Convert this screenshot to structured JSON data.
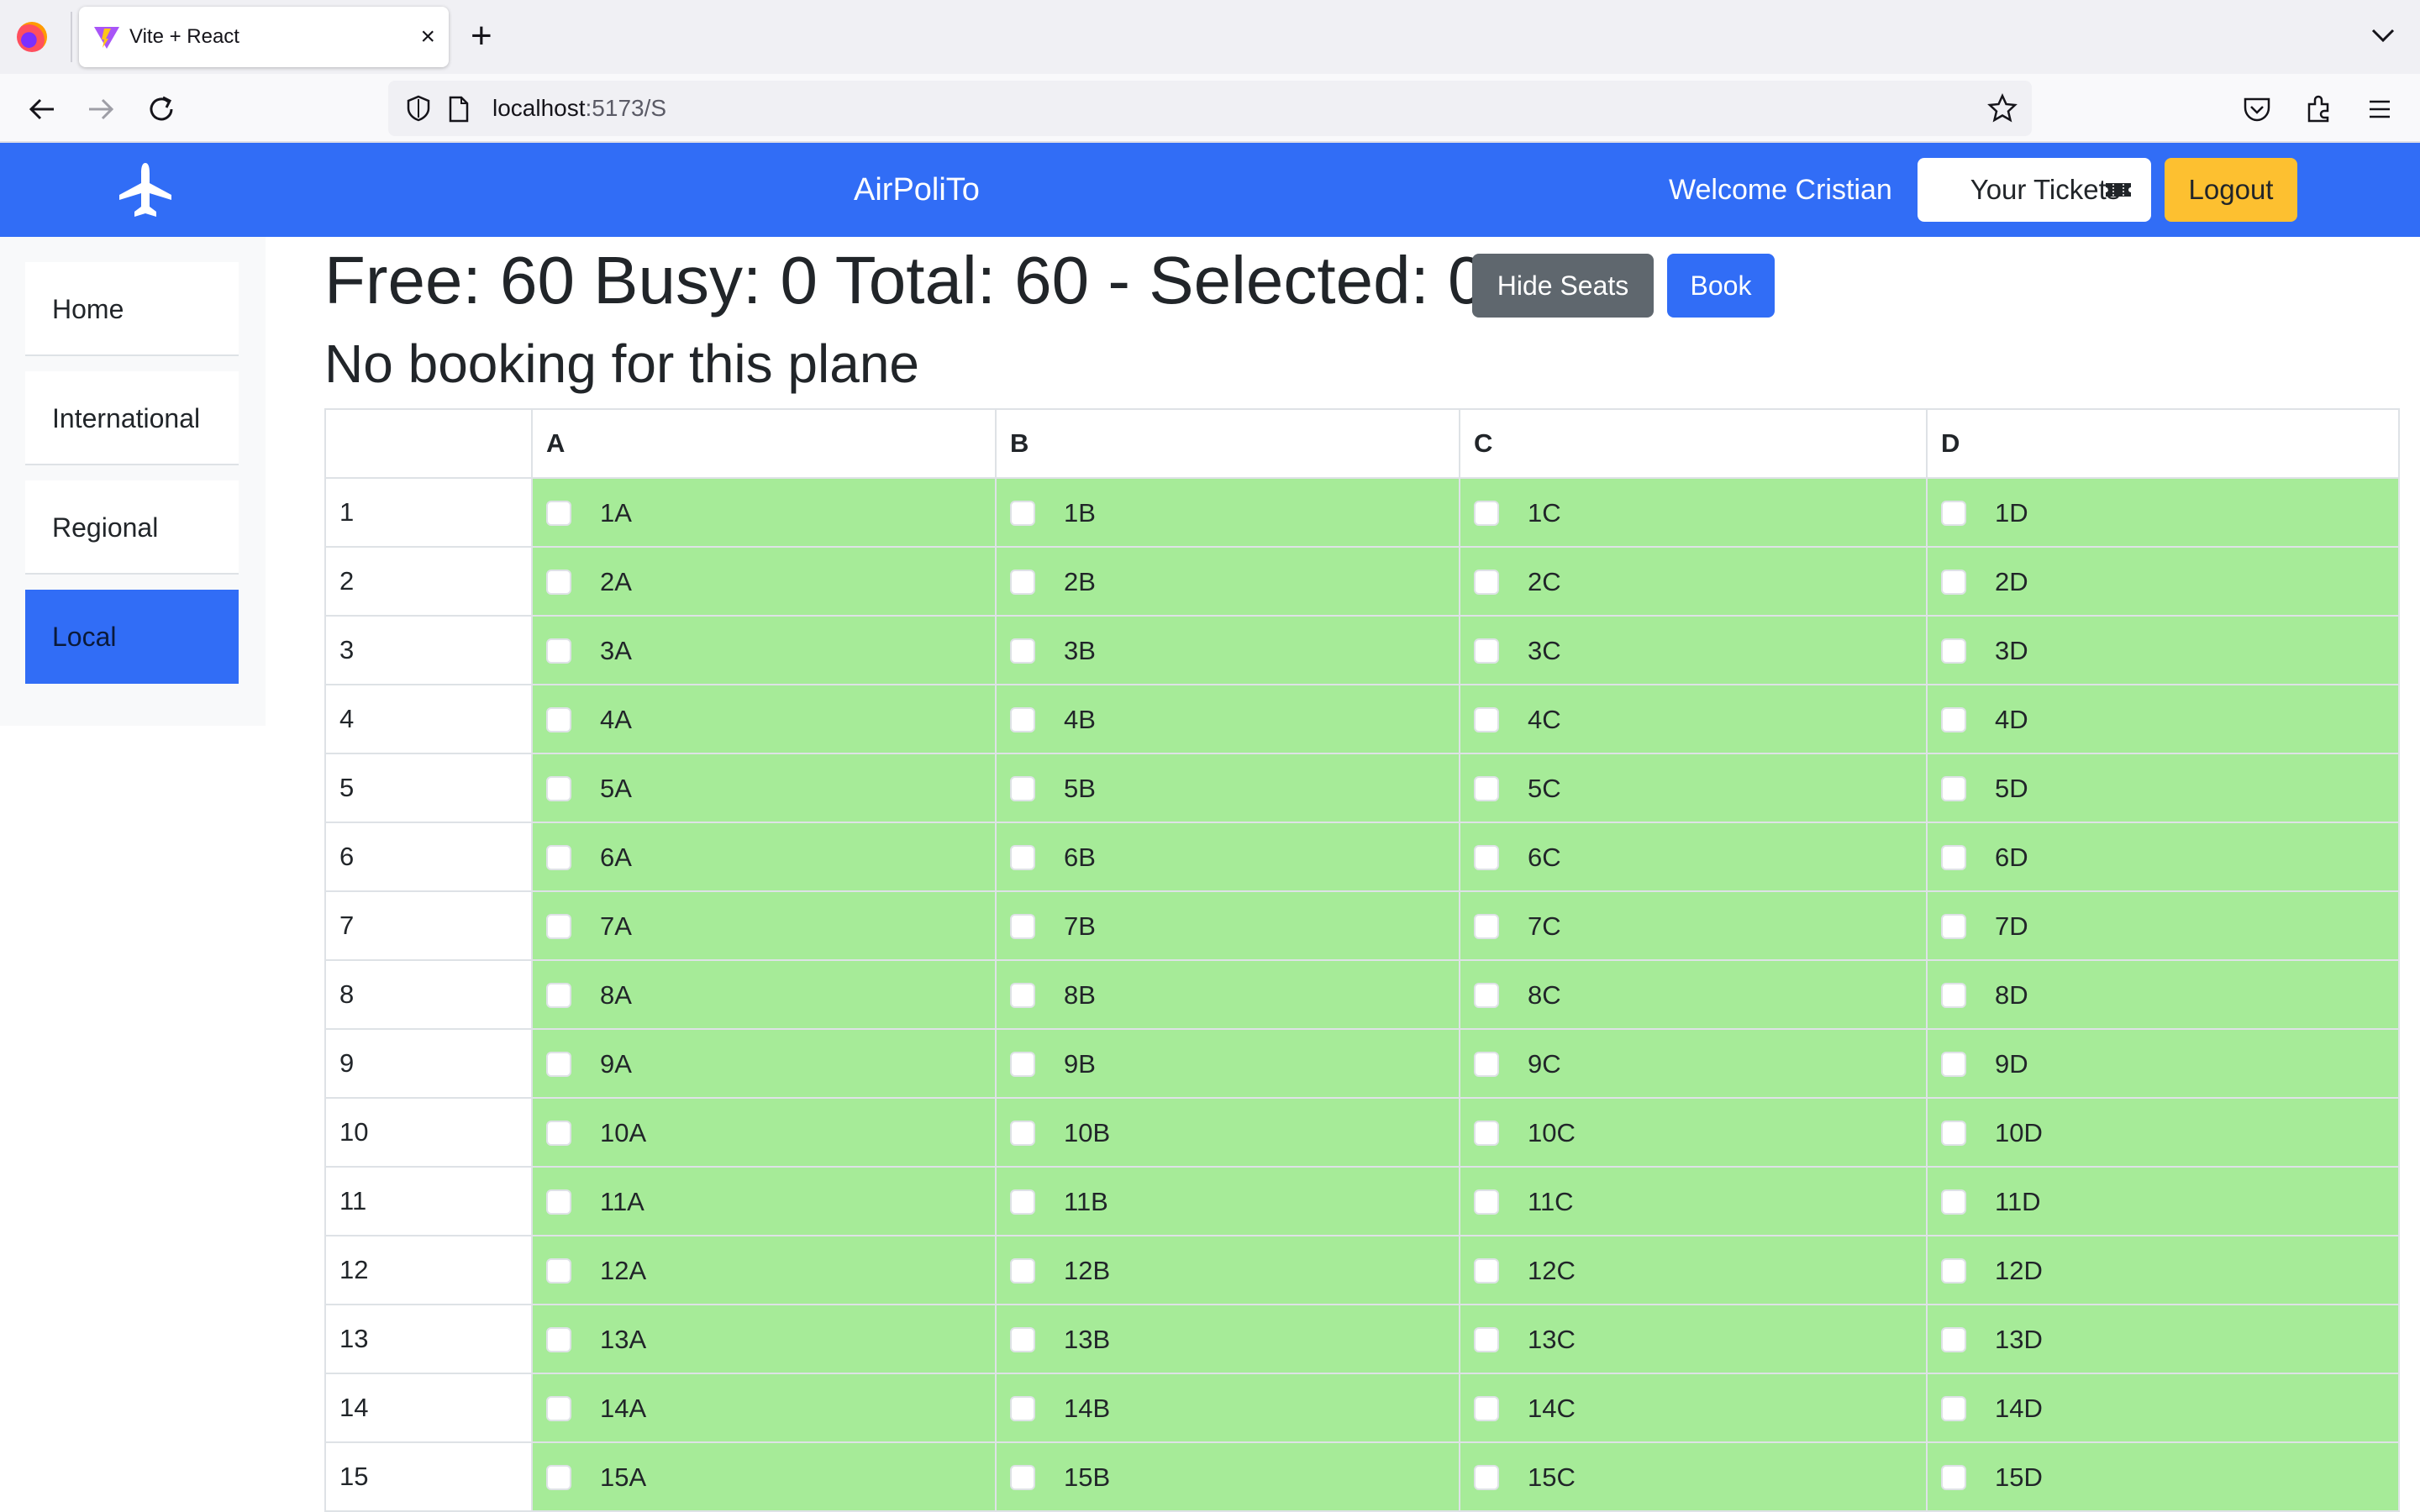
{
  "browser": {
    "tab_title": "Vite + React",
    "close_glyph": "×",
    "new_tab_glyph": "+",
    "url_host": "localhost",
    "url_rest": ":5173/S"
  },
  "app": {
    "brand": "AirPoliTo",
    "welcome": "Welcome Cristian",
    "tickets_label": "Your Tickets",
    "logout_label": "Logout",
    "accent": "#316df6",
    "free_seat_color": "#a6eb98"
  },
  "sidebar": {
    "items": [
      {
        "label": "Home",
        "active": false
      },
      {
        "label": "International",
        "active": false
      },
      {
        "label": "Regional",
        "active": false
      },
      {
        "label": "Local",
        "active": true
      }
    ]
  },
  "main": {
    "stats_text": "Free: 60 Busy: 0 Total: 60 - Selected: 0",
    "hide_seats_label": "Hide Seats",
    "book_label": "Book",
    "booking_status": "No booking for this plane",
    "columns": [
      "",
      "A",
      "B",
      "C",
      "D"
    ],
    "rows": [
      {
        "num": "1",
        "seats": [
          "1A",
          "1B",
          "1C",
          "1D"
        ]
      },
      {
        "num": "2",
        "seats": [
          "2A",
          "2B",
          "2C",
          "2D"
        ]
      },
      {
        "num": "3",
        "seats": [
          "3A",
          "3B",
          "3C",
          "3D"
        ]
      },
      {
        "num": "4",
        "seats": [
          "4A",
          "4B",
          "4C",
          "4D"
        ]
      },
      {
        "num": "5",
        "seats": [
          "5A",
          "5B",
          "5C",
          "5D"
        ]
      },
      {
        "num": "6",
        "seats": [
          "6A",
          "6B",
          "6C",
          "6D"
        ]
      },
      {
        "num": "7",
        "seats": [
          "7A",
          "7B",
          "7C",
          "7D"
        ]
      },
      {
        "num": "8",
        "seats": [
          "8A",
          "8B",
          "8C",
          "8D"
        ]
      },
      {
        "num": "9",
        "seats": [
          "9A",
          "9B",
          "9C",
          "9D"
        ]
      },
      {
        "num": "10",
        "seats": [
          "10A",
          "10B",
          "10C",
          "10D"
        ]
      },
      {
        "num": "11",
        "seats": [
          "11A",
          "11B",
          "11C",
          "11D"
        ]
      },
      {
        "num": "12",
        "seats": [
          "12A",
          "12B",
          "12C",
          "12D"
        ]
      },
      {
        "num": "13",
        "seats": [
          "13A",
          "13B",
          "13C",
          "13D"
        ]
      },
      {
        "num": "14",
        "seats": [
          "14A",
          "14B",
          "14C",
          "14D"
        ]
      },
      {
        "num": "15",
        "seats": [
          "15A",
          "15B",
          "15C",
          "15D"
        ]
      }
    ]
  }
}
